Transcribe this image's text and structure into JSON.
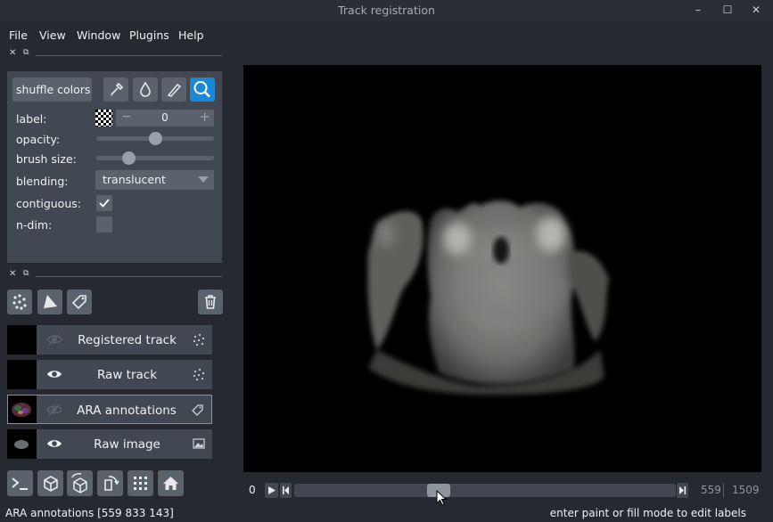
{
  "window": {
    "title": "Track registration"
  },
  "menu": [
    "File",
    "View",
    "Window",
    "Plugins",
    "Help"
  ],
  "controls": {
    "shuffle_label": "shuffle colors",
    "label_label": "label:",
    "label_value": "0",
    "opacity_label": "opacity:",
    "opacity_value": 0.5,
    "brush_label": "brush size:",
    "brush_value": 0.25,
    "blending_label": "blending:",
    "blending_value": "translucent",
    "contiguous_label": "contiguous:",
    "contiguous_checked": true,
    "ndim_label": "n-dim:",
    "ndim_checked": false,
    "minus": "−",
    "plus": "+"
  },
  "layers": [
    {
      "name": "Registered track",
      "visible": false,
      "type": "points-icon"
    },
    {
      "name": "Raw track",
      "visible": true,
      "type": "points-icon"
    },
    {
      "name": "ARA annotations",
      "visible": false,
      "type": "label-tag-icon",
      "selected": true
    },
    {
      "name": "Raw image",
      "visible": true,
      "type": "image-icon"
    }
  ],
  "dims": {
    "start": "0",
    "current": "559",
    "total": "1509",
    "position": 0.37
  },
  "status": {
    "left": "ARA annotations [559 833 143]",
    "right": "enter paint or fill mode to edit labels"
  },
  "colors": {
    "background": "#262930",
    "panel": "#414851",
    "button": "#5a626c",
    "accent": "#1a88d3"
  }
}
